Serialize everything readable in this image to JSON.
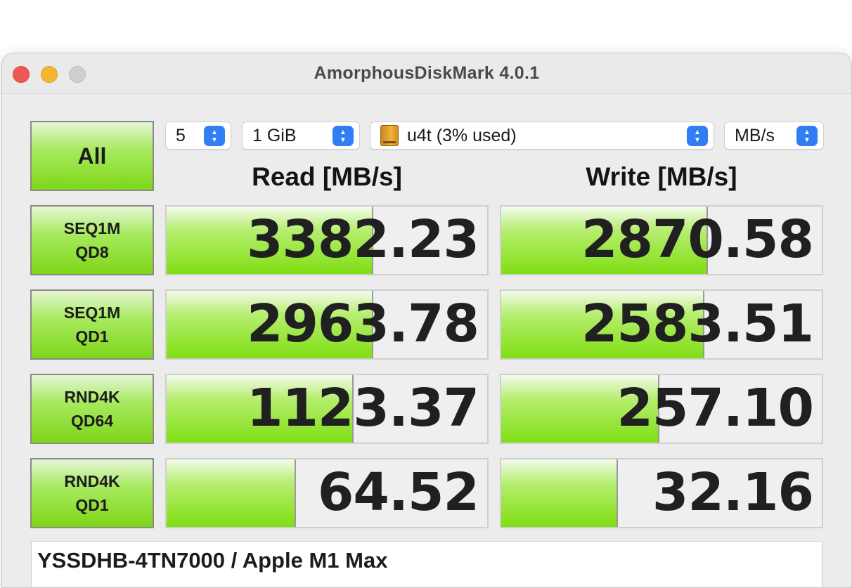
{
  "window": {
    "title": "AmorphousDiskMark 4.0.1"
  },
  "controls": {
    "all_label": "All",
    "count": "5",
    "size": "1 GiB",
    "drive": "u4t (3% used)",
    "unit": "MB/s"
  },
  "headers": {
    "read": "Read [MB/s]",
    "write": "Write [MB/s]"
  },
  "rows": [
    {
      "label": "SEQ1M\nQD8",
      "read": "3382.23",
      "write": "2870.58",
      "read_fraction": 0.64,
      "write_fraction": 0.64
    },
    {
      "label": "SEQ1M\nQD1",
      "read": "2963.78",
      "write": "2583.51",
      "read_fraction": 0.64,
      "write_fraction": 0.63
    },
    {
      "label": "RND4K\nQD64",
      "read": "1123.37",
      "write": "257.10",
      "read_fraction": 0.58,
      "write_fraction": 0.49
    },
    {
      "label": "RND4K\nQD1",
      "read": "64.52",
      "write": "32.16",
      "read_fraction": 0.4,
      "write_fraction": 0.36
    }
  ],
  "footer": {
    "text": "YSSDHB-4TN7000 / Apple M1 Max"
  },
  "colors": {
    "bar_green": "#80de13",
    "select_accent": "#2f7ff3"
  }
}
